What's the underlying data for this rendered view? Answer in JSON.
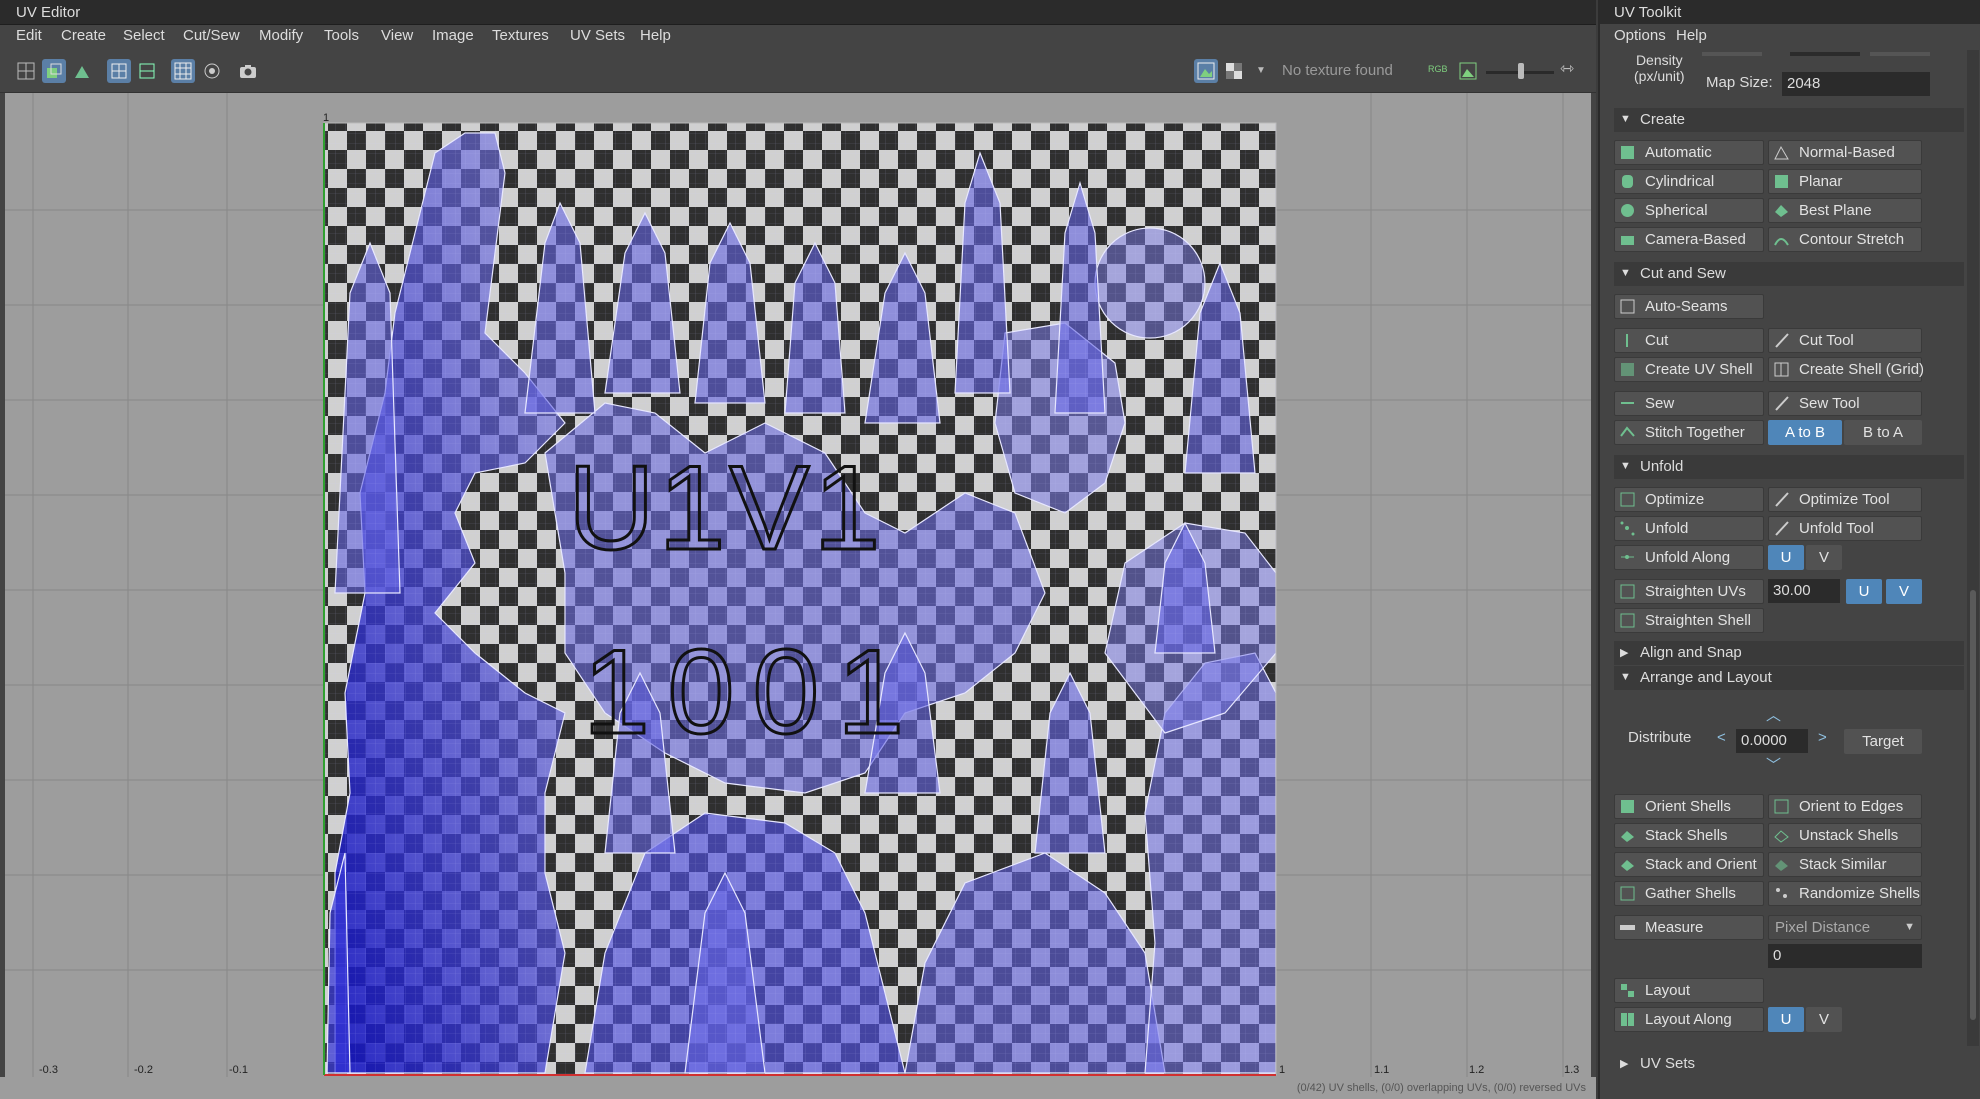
{
  "uv_editor": {
    "title": "UV Editor",
    "menu": [
      "Edit",
      "Create",
      "Select",
      "Cut/Sew",
      "Modify",
      "Tools",
      "View",
      "Image",
      "Textures",
      "UV Sets",
      "Help"
    ],
    "no_texture": "No texture found",
    "tile_text_1": "U1V1",
    "tile_text_2": "1001",
    "axis_ticks_x": [
      "-0.3",
      "-0.2",
      "-0.1",
      "1",
      "1.1",
      "1.2",
      "1.3"
    ],
    "axis_tick_top": "1",
    "status": "(0/42) UV shells, (0/0) overlapping UVs, (0/0) reversed UVs",
    "colors": {
      "shell_fill": "#2d2dd0",
      "checker_dark": "#2f2f2f",
      "checker_light": "#d0d0d0",
      "grid_bg": "#9d9d9d"
    }
  },
  "toolkit": {
    "title": "UV Toolkit",
    "menu": [
      "Options",
      "Help"
    ],
    "density_label": "Density\n(px/unit)",
    "map_size_label": "Map Size:",
    "map_size_value": "2048",
    "sections": {
      "create": "Create",
      "cut_and_sew": "Cut and Sew",
      "unfold": "Unfold",
      "align_and_snap": "Align and Snap",
      "arrange_and_layout": "Arrange and Layout",
      "uv_sets": "UV Sets"
    },
    "create_buttons": [
      [
        "Automatic",
        "Normal-Based"
      ],
      [
        "Cylindrical",
        "Planar"
      ],
      [
        "Spherical",
        "Best Plane"
      ],
      [
        "Camera-Based",
        "Contour Stretch"
      ]
    ],
    "auto_seams": "Auto-Seams",
    "cut": "Cut",
    "cut_tool": "Cut Tool",
    "create_uv_shell": "Create UV Shell",
    "create_shell_grid": "Create Shell (Grid)",
    "sew": "Sew",
    "sew_tool": "Sew Tool",
    "stitch_together": "Stitch Together",
    "a_to_b": "A to B",
    "b_to_a": "B to A",
    "optimize": "Optimize",
    "optimize_tool": "Optimize Tool",
    "unfold": "Unfold",
    "unfold_tool": "Unfold Tool",
    "unfold_along": "Unfold Along",
    "u": "U",
    "v": "V",
    "straighten_uvs": "Straighten UVs",
    "straighten_value": "30.00",
    "straighten_shell": "Straighten Shell",
    "distribute": "Distribute",
    "distribute_value": "0.0000",
    "target": "Target",
    "arrange_buttons": [
      [
        "Orient Shells",
        "Orient to Edges"
      ],
      [
        "Stack Shells",
        "Unstack Shells"
      ],
      [
        "Stack and Orient",
        "Stack Similar"
      ],
      [
        "Gather Shells",
        "Randomize Shells"
      ]
    ],
    "measure": "Measure",
    "measure_mode": "Pixel Distance",
    "measure_value": "0",
    "layout": "Layout",
    "layout_along": "Layout Along"
  }
}
